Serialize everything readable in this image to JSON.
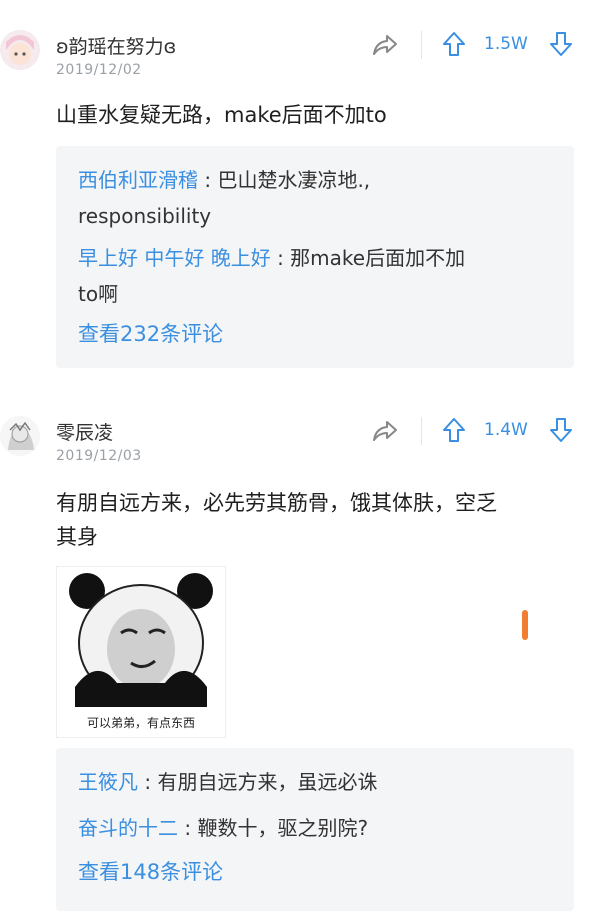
{
  "posts": [
    {
      "username": "ʚ韵瑶在努力ɞ",
      "date": "2019/12/02",
      "votes": "1.5W",
      "content": "山重水复疑无路，make后面不加to",
      "replies": [
        {
          "name": "西伯利亚滑稽",
          "sep": " : ",
          "text": "巴山楚水凄凉地.,",
          "text2": "responsibility"
        },
        {
          "name": "早上好 中午好 晚上好",
          "sep": " : ",
          "text": "那make后面加不加",
          "text2": "to啊"
        }
      ],
      "view_more": "查看232条评论"
    },
    {
      "username": "零辰凌",
      "date": "2019/12/03",
      "votes": "1.4W",
      "content_line1": "有朋自远方来，必先劳其筋骨，饿其体肤，空乏",
      "content_line2": "其身",
      "meme_caption": "可以弟弟，有点东西",
      "replies": [
        {
          "name": "王筱凡",
          "sep": " : ",
          "text": "有朋自远方来，虽远必诛"
        },
        {
          "name": "奋斗的十二",
          "sep": " : ",
          "text": "鞭数十，驱之别院?"
        }
      ],
      "view_more": "查看148条评论"
    }
  ],
  "colors": {
    "accent": "#3a8fe0",
    "reply_bg": "#f4f5f7",
    "marker": "#f07d30"
  },
  "icons": [
    "share-icon",
    "upvote-arrow-icon",
    "downvote-arrow-icon"
  ]
}
